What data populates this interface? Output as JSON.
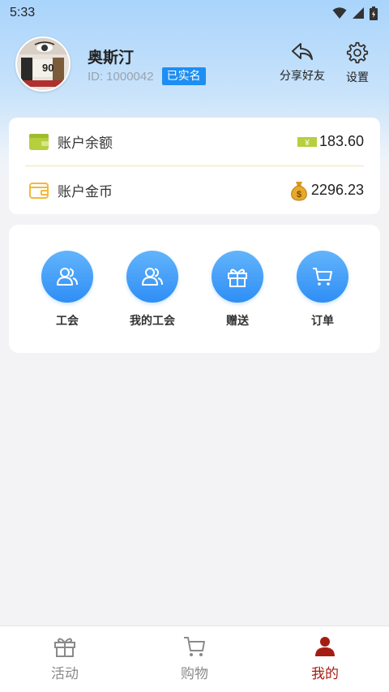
{
  "status_bar": {
    "time": "5:33"
  },
  "profile": {
    "name": "奥斯汀",
    "id_label": "ID:",
    "id_value": "1000042",
    "verified": "已实名",
    "avatar_text": "90"
  },
  "actions": {
    "share": "分享好友",
    "settings": "设置"
  },
  "balance": {
    "items": [
      {
        "label": "账户余额",
        "value": "183.60"
      },
      {
        "label": "账户金币",
        "value": "2296.23"
      }
    ]
  },
  "menu": {
    "items": [
      {
        "label": "工会",
        "icon": "users-icon"
      },
      {
        "label": "我的工会",
        "icon": "users-icon"
      },
      {
        "label": "赠送",
        "icon": "gift-icon"
      },
      {
        "label": "订单",
        "icon": "cart-icon"
      }
    ]
  },
  "tabbar": {
    "items": [
      {
        "label": "活动",
        "icon": "gift-icon"
      },
      {
        "label": "购物",
        "icon": "cart-icon"
      },
      {
        "label": "我的",
        "icon": "person-icon"
      }
    ],
    "active_color": "#a51d12",
    "inactive_color": "#8a8a8a"
  },
  "colors": {
    "accent": "#1d8ef2",
    "menu_icon_bg": "#3d9af7",
    "wallet_green": "#b6cf3e",
    "wallet_yellow": "#f4b83a"
  }
}
